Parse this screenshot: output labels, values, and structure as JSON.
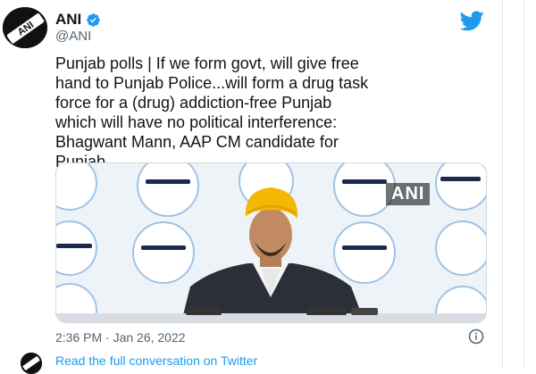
{
  "account": {
    "name": "ANI",
    "handle": "@ANI",
    "logo_text": "ANI"
  },
  "tweet": {
    "text": "Punjab polls | If we form govt, will give free\nhand to Punjab Police...will form a drug task\nforce for a (drug) addiction-free Punjab\nwhich will have no political interference:\nBhagwant Mann, AAP CM candidate for\nPunjab",
    "timestamp": "2:36 PM · Jan 26, 2022"
  },
  "media": {
    "watermark": "ANI"
  },
  "footer": {
    "read_link": "Read the full conversation on Twitter"
  },
  "icons": {
    "verified": "verified-badge-icon",
    "bird": "twitter-bird-icon",
    "info": "info-icon"
  },
  "colors": {
    "twitter_blue": "#1d9bf0",
    "text": "#0f1419",
    "secondary": "#536471",
    "turban": "#f5b800"
  }
}
